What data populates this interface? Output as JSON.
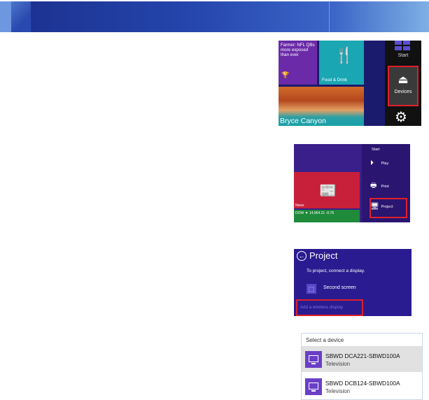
{
  "start_screen": {
    "news_tile_text": "Farmer: NFL QBs more exposed than ever",
    "food_tile_label": "Food & Drink",
    "photo_tile_caption": "Bryce Canyon",
    "charm_start_label": "Start",
    "charm_devices_label": "Devices"
  },
  "devices_charm": {
    "title": "Start",
    "items": [
      {
        "label": "Play",
        "icon": "play-icon"
      },
      {
        "label": "Print",
        "icon": "printer-icon"
      },
      {
        "label": "Project",
        "icon": "project-icon"
      }
    ],
    "news_tile_label": "News",
    "dow_tile_text": "DOW    ▼ 14,964.21 -8.78"
  },
  "project_flyout": {
    "title": "Project",
    "subtitle": "To project, connect a display.",
    "second_screen_label": "Second screen",
    "add_wireless_label": "Add a wireless display"
  },
  "select_device": {
    "header": "Select a device",
    "devices": [
      {
        "name": "SBWD DCA221-SBWD100A",
        "type": "Television"
      },
      {
        "name": "SBWD DCB124-SBWD100A",
        "type": "Television"
      }
    ]
  },
  "colors": {
    "highlight": "#e0202a",
    "accent": "#6a3fc6",
    "banner": "#2546ad"
  }
}
